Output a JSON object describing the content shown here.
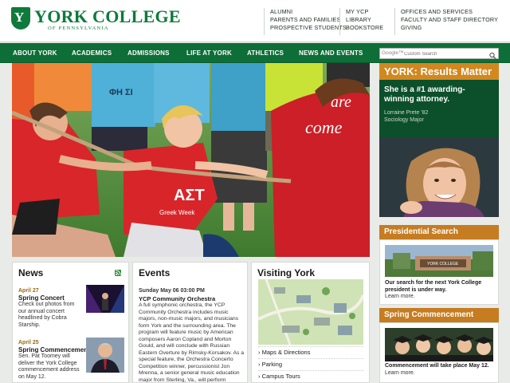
{
  "header": {
    "logo_name": "YORK COLLEGE",
    "logo_sub": "OF PENNSYLVANIA",
    "links_col1": [
      "ALUMNI",
      "PARENTS AND FAMILIES",
      "PROSPECTIVE STUDENTS"
    ],
    "links_col2": [
      "MY YCP",
      "LIBRARY",
      "BOOKSTORE"
    ],
    "links_col3": [
      "OFFICES AND SERVICES",
      "FACULTY AND STAFF DIRECTORY",
      "GIVING"
    ]
  },
  "nav": {
    "items": [
      "ABOUT YORK",
      "ACADEMICS",
      "ADMISSIONS",
      "LIFE AT YORK",
      "ATHLETICS",
      "NEWS AND EVENTS"
    ]
  },
  "search": {
    "google_label": "Google™",
    "placeholder": "Custom Search"
  },
  "hero": {
    "shirt_text_1": "ΑΣΤ",
    "shirt_text_2": "Greek Week",
    "shirt_text_3": "ΦΗ ΣΙ",
    "shirt_text_4": "are",
    "shirt_text_5": "come"
  },
  "results": {
    "brand": "YORK:",
    "headline": "Results Matter",
    "quote": "She is a #1 awarding-winning attorney.",
    "person": "Lorraine Prete '82",
    "major": "Sociology Major"
  },
  "presidential": {
    "title": "Presidential Search",
    "sign_text": "YORK COLLEGE",
    "text": "Our search for the next York College president is under way.",
    "more": "Learn more."
  },
  "commencement": {
    "title": "Spring Commencement",
    "text": "Commencement will take place May 12.",
    "more": "Learn more."
  },
  "news": {
    "title": "News",
    "items": [
      {
        "date": "April 27",
        "headline": "Spring Concert",
        "body": "Check out photos from our annual concert headlined by Cobra Starship."
      },
      {
        "date": "April 25",
        "headline": "Spring Commencement",
        "body": "Sen. Pat Toomey will deliver the York College commencement address on May 12."
      }
    ]
  },
  "events": {
    "title": "Events",
    "date": "Sunday May 06  03:00 PM",
    "headline": "YCP Community Orchestra",
    "body": "A full symphonic orchestra, the YCP Community Orchestra includes music majors, non-music majors, and musicians form York and the surrounding area. The program will feature music by American composers Aaron Copland and Morton Gould, and will conclude with Russian Eastern Overture by Rimsky-Korsakov. As a special feature, the Orchestra Concerto Competition winner, percussionist Jon Mrenna, a senior general music education major from Sterling, Va., will perform Concerto for Percussion and Orchestra by"
  },
  "visiting": {
    "title": "Visiting York",
    "links": [
      "Maps & Directions",
      "Parking",
      "Campus Tours"
    ]
  },
  "colors": {
    "brand_green": "#0f7a3c",
    "nav_green": "#0e6e37",
    "accent_orange": "#c67c21",
    "quote_bg": "#0c4f2b"
  }
}
